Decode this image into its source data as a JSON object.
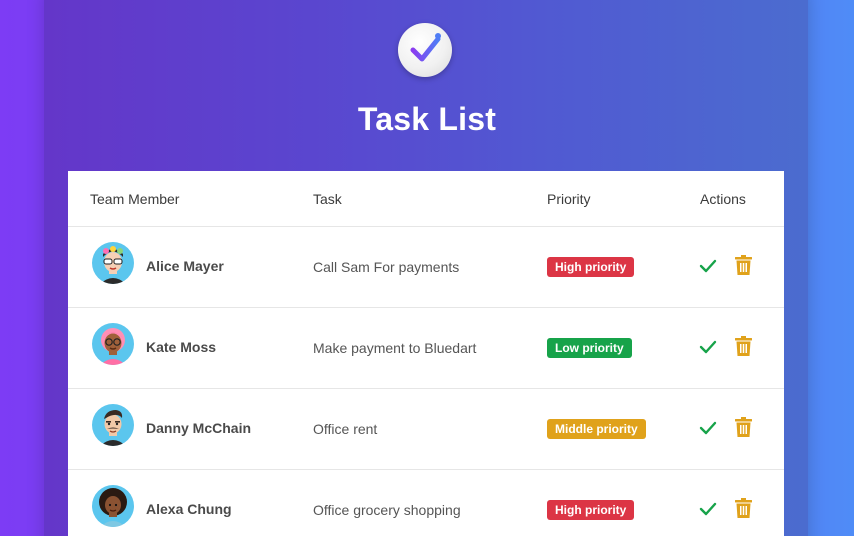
{
  "app": {
    "title": "Task List",
    "logo_icon": "check-circle-icon"
  },
  "table": {
    "headers": [
      "Team Member",
      "Task",
      "Priority",
      "Actions"
    ],
    "rows": [
      {
        "member": "Alice Mayer",
        "task": "Call Sam For payments",
        "priority": "High priority",
        "priority_color": "#dc3545",
        "avatar": "avatar-alice"
      },
      {
        "member": "Kate Moss",
        "task": "Make payment to Bluedart",
        "priority": "Low priority",
        "priority_color": "#17a34a",
        "avatar": "avatar-kate"
      },
      {
        "member": "Danny McChain",
        "task": "Office rent",
        "priority": "Middle priority",
        "priority_color": "#e0a21b",
        "avatar": "avatar-danny"
      },
      {
        "member": "Alexa Chung",
        "task": "Office grocery shopping",
        "priority": "High priority",
        "priority_color": "#dc3545",
        "avatar": "avatar-alexa"
      }
    ]
  },
  "colors": {
    "complete_icon": "#17a34a",
    "delete_icon": "#e0a21b",
    "accent": "#7c3aed"
  },
  "actions": {
    "complete_icon": "check-icon",
    "delete_icon": "trash-icon"
  }
}
